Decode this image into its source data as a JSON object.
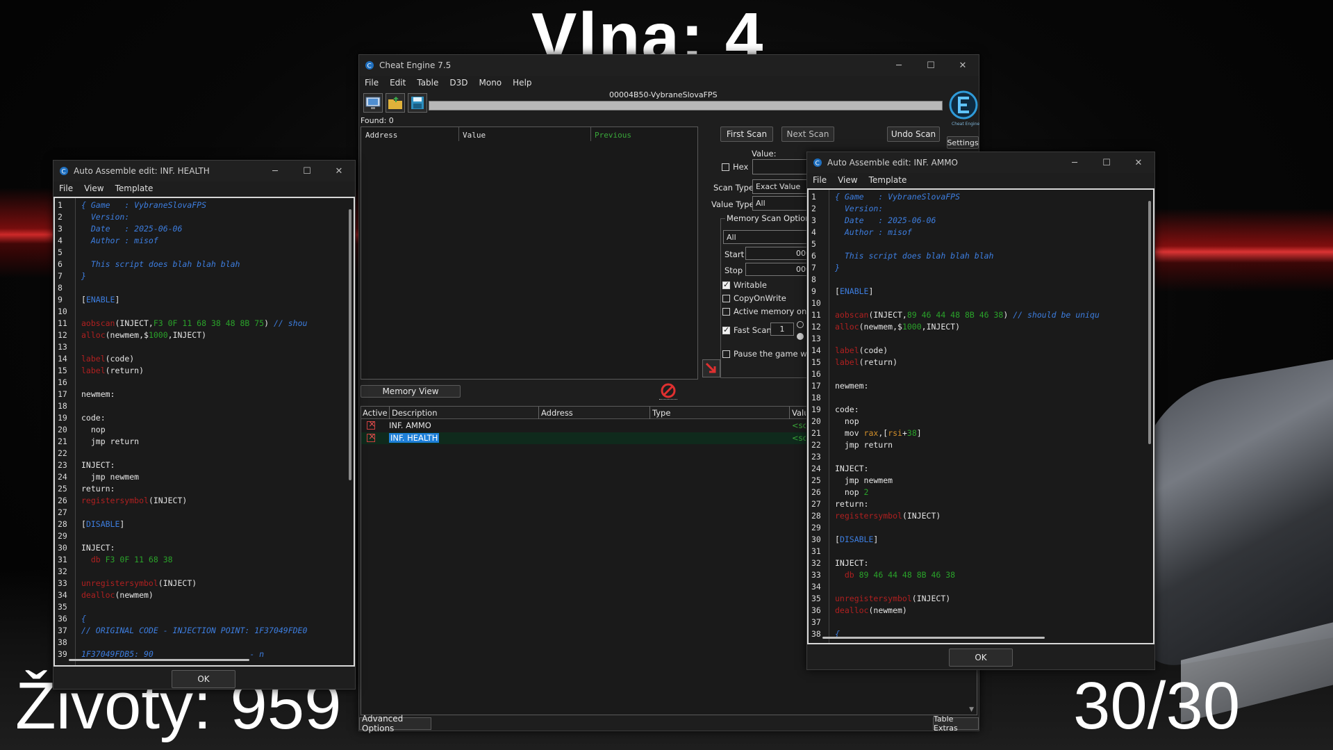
{
  "game": {
    "wave_text": "Vlna: 4",
    "lives_text": "Životy: 959",
    "ammo_text": "30/30"
  },
  "ce_main": {
    "title": "Cheat Engine 7.5",
    "menu": [
      "File",
      "Edit",
      "Table",
      "D3D",
      "Mono",
      "Help"
    ],
    "process": "00004B50-VybraneSlovaFPS",
    "found": "Found: 0",
    "columns": {
      "address": "Address",
      "value": "Value",
      "previous": "Previous"
    },
    "buttons": {
      "first_scan": "First Scan",
      "next_scan": "Next Scan",
      "undo_scan": "Undo Scan",
      "settings": "Settings",
      "memory_view": "Memory View",
      "advanced_options": "Advanced Options",
      "table_extras": "Table Extras"
    },
    "value_label": "Value:",
    "hex_label": "Hex",
    "scan_type_label": "Scan Type",
    "scan_type_value": "Exact Value",
    "value_type_label": "Value Type",
    "value_type_value": "All",
    "memory_scan_options": "Memory Scan Options",
    "region_value": "All",
    "start_label": "Start",
    "start_value": "000",
    "stop_label": "Stop",
    "stop_value": "000",
    "writable": "Writable",
    "copy_on_write": "CopyOnWrite",
    "active_memory_only": "Active memory only",
    "fast_scan": "Fast Scan",
    "fast_scan_value": "1",
    "pause_game": "Pause the game whi",
    "logo_caption": "Cheat Engine",
    "table_columns": {
      "active": "Active",
      "description": "Description",
      "address": "Address",
      "type": "Type",
      "value": "Valu"
    },
    "table_rows": [
      {
        "description": "INF. AMMO",
        "value": "<scri"
      },
      {
        "description": "INF. HEALTH",
        "value": "<scri"
      }
    ]
  },
  "health_editor": {
    "title": "Auto Assemble edit: INF. HEALTH",
    "menu": [
      "File",
      "View",
      "Template"
    ],
    "ok": "OK"
  },
  "ammo_editor": {
    "title": "Auto Assemble edit: INF. AMMO",
    "menu": [
      "File",
      "View",
      "Template"
    ],
    "ok": "OK"
  },
  "health_code": [
    [
      [
        "cm",
        "{ Game   : VybraneSlovaFPS"
      ]
    ],
    [
      [
        "cm",
        "  Version:"
      ]
    ],
    [
      [
        "cm",
        "  Date   : 2025-06-06"
      ]
    ],
    [
      [
        "cm",
        "  Author : misof"
      ]
    ],
    [],
    [
      [
        "cm",
        "  This script does blah blah blah"
      ]
    ],
    [
      [
        "cm",
        "}"
      ]
    ],
    [],
    [
      [
        "t",
        "["
      ],
      [
        "sec",
        "ENABLE"
      ],
      [
        "t",
        "]"
      ]
    ],
    [],
    [
      [
        "kw",
        "aobscan"
      ],
      [
        "t",
        "(INJECT,"
      ],
      [
        "num",
        "F3 0F 11 68 38 48 8B 75"
      ],
      [
        "t",
        ") "
      ],
      [
        "cm",
        "// shou"
      ]
    ],
    [
      [
        "kw",
        "alloc"
      ],
      [
        "t",
        "(newmem,$"
      ],
      [
        "num",
        "1000"
      ],
      [
        "t",
        ",INJECT)"
      ]
    ],
    [],
    [
      [
        "kw",
        "label"
      ],
      [
        "t",
        "(code)"
      ]
    ],
    [
      [
        "kw",
        "label"
      ],
      [
        "t",
        "(return)"
      ]
    ],
    [],
    [
      [
        "t",
        "newmem:"
      ]
    ],
    [],
    [
      [
        "t",
        "code:"
      ]
    ],
    [
      [
        "t",
        "  nop"
      ]
    ],
    [
      [
        "t",
        "  jmp return"
      ]
    ],
    [],
    [
      [
        "t",
        "INJECT:"
      ]
    ],
    [
      [
        "t",
        "  jmp newmem"
      ]
    ],
    [
      [
        "t",
        "return:"
      ]
    ],
    [
      [
        "kw",
        "registersymbol"
      ],
      [
        "t",
        "(INJECT)"
      ]
    ],
    [],
    [
      [
        "t",
        "["
      ],
      [
        "sec",
        "DISABLE"
      ],
      [
        "t",
        "]"
      ]
    ],
    [],
    [
      [
        "t",
        "INJECT:"
      ]
    ],
    [
      [
        "kw",
        "  db "
      ],
      [
        "num",
        "F3 0F 11 68 38"
      ]
    ],
    [],
    [
      [
        "kw",
        "unregistersymbol"
      ],
      [
        "t",
        "(INJECT)"
      ]
    ],
    [
      [
        "kw",
        "dealloc"
      ],
      [
        "t",
        "(newmem)"
      ]
    ],
    [],
    [
      [
        "cm",
        "{"
      ]
    ],
    [
      [
        "cm",
        "// ORIGINAL CODE - INJECTION POINT: 1F37049FDE0"
      ]
    ],
    [],
    [
      [
        "cm",
        "1F37049FDB5: 90                    - n"
      ]
    ]
  ],
  "ammo_code": [
    [
      [
        "cm",
        "{ Game   : VybraneSlovaFPS"
      ]
    ],
    [
      [
        "cm",
        "  Version:"
      ]
    ],
    [
      [
        "cm",
        "  Date   : 2025-06-06"
      ]
    ],
    [
      [
        "cm",
        "  Author : misof"
      ]
    ],
    [],
    [
      [
        "cm",
        "  This script does blah blah blah"
      ]
    ],
    [
      [
        "cm",
        "}"
      ]
    ],
    [],
    [
      [
        "t",
        "["
      ],
      [
        "sec",
        "ENABLE"
      ],
      [
        "t",
        "]"
      ]
    ],
    [],
    [
      [
        "kw",
        "aobscan"
      ],
      [
        "t",
        "(INJECT,"
      ],
      [
        "num",
        "89 46 44 48 8B 46 38"
      ],
      [
        "t",
        ") "
      ],
      [
        "cm",
        "// should be uniqu"
      ]
    ],
    [
      [
        "kw",
        "alloc"
      ],
      [
        "t",
        "(newmem,$"
      ],
      [
        "num",
        "1000"
      ],
      [
        "t",
        ",INJECT)"
      ]
    ],
    [],
    [
      [
        "kw",
        "label"
      ],
      [
        "t",
        "(code)"
      ]
    ],
    [
      [
        "kw",
        "label"
      ],
      [
        "t",
        "(return)"
      ]
    ],
    [],
    [
      [
        "t",
        "newmem:"
      ]
    ],
    [],
    [
      [
        "t",
        "code:"
      ]
    ],
    [
      [
        "t",
        "  nop"
      ]
    ],
    [
      [
        "t",
        "  mov "
      ],
      [
        "reg",
        "rax"
      ],
      [
        "t",
        ",["
      ],
      [
        "reg",
        "rsi"
      ],
      [
        "t",
        "+"
      ],
      [
        "num",
        "38"
      ],
      [
        "t",
        "]"
      ]
    ],
    [
      [
        "t",
        "  jmp return"
      ]
    ],
    [],
    [
      [
        "t",
        "INJECT:"
      ]
    ],
    [
      [
        "t",
        "  jmp newmem"
      ]
    ],
    [
      [
        "t",
        "  nop "
      ],
      [
        "num",
        "2"
      ]
    ],
    [
      [
        "t",
        "return:"
      ]
    ],
    [
      [
        "kw",
        "registersymbol"
      ],
      [
        "t",
        "(INJECT)"
      ]
    ],
    [],
    [
      [
        "t",
        "["
      ],
      [
        "sec",
        "DISABLE"
      ],
      [
        "t",
        "]"
      ]
    ],
    [],
    [
      [
        "t",
        "INJECT:"
      ]
    ],
    [
      [
        "kw",
        "  db "
      ],
      [
        "num",
        "89 46 44 48 8B 46 38"
      ]
    ],
    [],
    [
      [
        "kw",
        "unregistersymbol"
      ],
      [
        "t",
        "(INJECT)"
      ]
    ],
    [
      [
        "kw",
        "dealloc"
      ],
      [
        "t",
        "(newmem)"
      ]
    ],
    [],
    [
      [
        "cm",
        "{"
      ]
    ]
  ],
  "colors": {
    "comment": "#3d7ee0",
    "keyword": "#b02020",
    "number": "#2aa32a",
    "register": "#d4902a",
    "selection": "#1e7fd8",
    "red_glow": "#ff3030"
  },
  "icons": [
    "cheat-engine-logo-icon",
    "open-process-icon",
    "open-file-icon",
    "save-icon",
    "stop-scan-icon",
    "add-address-arrow-icon"
  ]
}
